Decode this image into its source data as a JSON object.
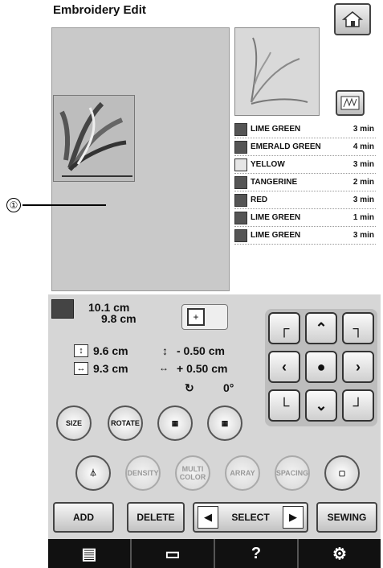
{
  "header": {
    "title": "Embroidery Edit"
  },
  "callout": {
    "number": "①"
  },
  "threads": [
    {
      "name": "LIME GREEN",
      "time": "3 min",
      "color": "#7a8a60",
      "light": false
    },
    {
      "name": "EMERALD GREEN",
      "time": "4 min",
      "color": "#2f3f30",
      "light": false
    },
    {
      "name": "YELLOW",
      "time": "3 min",
      "color": "#e6e6e6",
      "light": true
    },
    {
      "name": "TANGERINE",
      "time": "2 min",
      "color": "#7a7a7a",
      "light": false
    },
    {
      "name": "RED",
      "time": "3 min",
      "color": "#3a3a3a",
      "light": false
    },
    {
      "name": "LIME GREEN",
      "time": "1 min",
      "color": "#8a8a8a",
      "light": false
    },
    {
      "name": "LIME GREEN",
      "time": "3 min",
      "color": "#7a7a7a",
      "light": false
    }
  ],
  "size": {
    "width": "10.1 cm",
    "height": "9.8 cm"
  },
  "position": {
    "vertical_value": "9.6 cm",
    "horizontal_value": "9.3 cm",
    "vertical_offset": "- 0.50 cm",
    "horizontal_offset": "+ 0.50 cm",
    "rotation": "0°"
  },
  "tools": {
    "size": "SIZE",
    "rotate": "ROTATE",
    "density": "DENSITY",
    "multi_color": "MULTI COLOR",
    "array": "ARRAY",
    "spacing": "SPACING"
  },
  "actions": {
    "add": "ADD",
    "delete": "DELETE",
    "select": "SELECT",
    "sewing": "SEWING"
  },
  "bottom_bar": {
    "help": "?"
  }
}
